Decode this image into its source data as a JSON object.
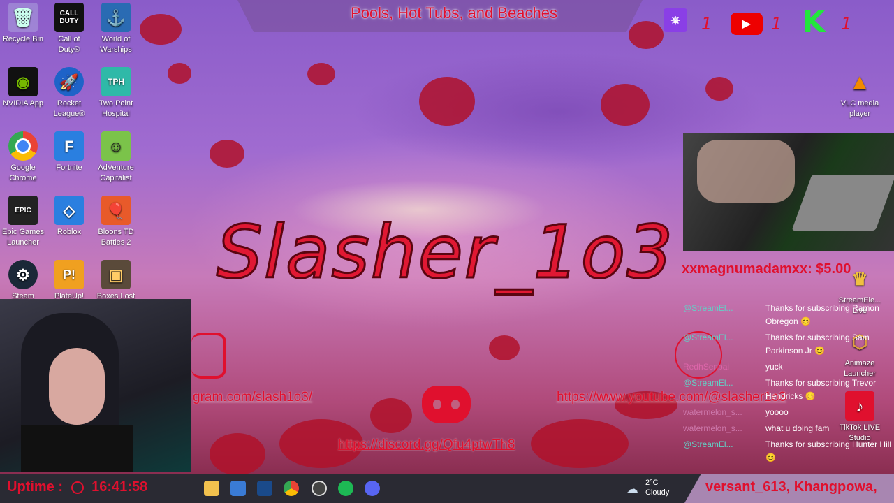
{
  "scene_title": "Pools, Hot Tubs, and Beaches",
  "brand_name": "Slasher_1o3",
  "desktop_icons": [
    {
      "label": "Recycle Bin",
      "icon": "recycle-bin-icon"
    },
    {
      "label": "Call of Duty®",
      "icon": "call-of-duty-icon"
    },
    {
      "label": "World of Warships",
      "icon": "world-of-warships-icon"
    },
    {
      "label": "NVIDIA App",
      "icon": "nvidia-icon"
    },
    {
      "label": "Rocket League®",
      "icon": "rocket-league-icon"
    },
    {
      "label": "Two Point Hospital",
      "icon": "two-point-hospital-icon"
    },
    {
      "label": "Google Chrome",
      "icon": "chrome-icon"
    },
    {
      "label": "Fortnite",
      "icon": "fortnite-icon"
    },
    {
      "label": "AdVenture Capitalist",
      "icon": "adventure-capitalist-icon"
    },
    {
      "label": "Epic Games Launcher",
      "icon": "epic-games-icon"
    },
    {
      "label": "Roblox",
      "icon": "roblox-icon"
    },
    {
      "label": "Bloons TD Battles 2",
      "icon": "bloons-icon"
    },
    {
      "label": "Steam",
      "icon": "steam-icon"
    },
    {
      "label": "PlateUp!",
      "icon": "plateup-icon"
    },
    {
      "label": "Boxes Lost",
      "icon": "boxes-lost-icon"
    }
  ],
  "right_icons": [
    {
      "label": "VLC media player",
      "icon": "vlc-icon"
    },
    {
      "label": "StreamEle... Live",
      "icon": "streamelements-icon"
    },
    {
      "label": "Animaze Launcher",
      "icon": "animaze-icon"
    },
    {
      "label": "TikTok LIVE Studio",
      "icon": "tiktok-icon"
    }
  ],
  "social_counts": {
    "twitch": "1",
    "youtube": "1",
    "kick": "1"
  },
  "links": {
    "instagram": "gram.com/slash1o3/",
    "youtube": "https://www.youtube.com/@slasher1o3",
    "discord": "https://discord.gg/Qfu4ptwTh8"
  },
  "tip_alert": "xxmagnumadamxx: $5.00",
  "chat": [
    {
      "user": "@StreamEl...",
      "msg": "Thanks for subscribing Ramon Obregon 😊"
    },
    {
      "user": "@StreamEl...",
      "msg": "Thanks for subscribing Sam Parkinson Jr 😊"
    },
    {
      "user": "RedhSenpai",
      "msg": "yuck"
    },
    {
      "user": "@StreamEl...",
      "msg": "Thanks for subscribing Trevor Hendricks 😊"
    },
    {
      "user": "watermelon_s...",
      "msg": "yoooo"
    },
    {
      "user": "watermelon_s...",
      "msg": "what u doing fam"
    },
    {
      "user": "@StreamEl...",
      "msg": "Thanks for subscribing Hunter Hill 😊"
    }
  ],
  "uptime": {
    "label": "Uptime :",
    "value": "16:41:58"
  },
  "weather": {
    "temp": "2°C",
    "condition": "Cloudy"
  },
  "ticker": "versant_613, Khangpowa,",
  "colors": {
    "accent": "#e0102e",
    "chat_user": "#63d0c6",
    "taskbar": "#2a2a33"
  }
}
